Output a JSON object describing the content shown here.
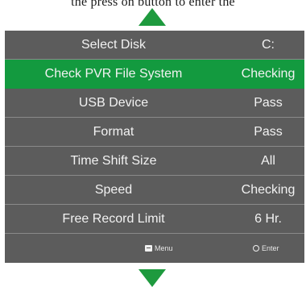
{
  "top_text": "the press on button to enter the",
  "menu": {
    "rows": [
      {
        "label": "Select Disk",
        "value": "C:"
      },
      {
        "label": "Check PVR File System",
        "value": "Checking",
        "selected": true
      },
      {
        "label": "USB Device",
        "value": "Pass"
      },
      {
        "label": "Format",
        "value": "Pass"
      },
      {
        "label": "Time Shift Size",
        "value": "All"
      },
      {
        "label": "Speed",
        "value": "Checking"
      },
      {
        "label": "Free Record Limit",
        "value": "6 Hr."
      }
    ],
    "footer": {
      "menu_label": "Menu",
      "enter_label": "Enter"
    }
  },
  "colors": {
    "accent": "#139a3f",
    "panel": "#5c5c5c",
    "arrow": "#1e9a3e"
  }
}
